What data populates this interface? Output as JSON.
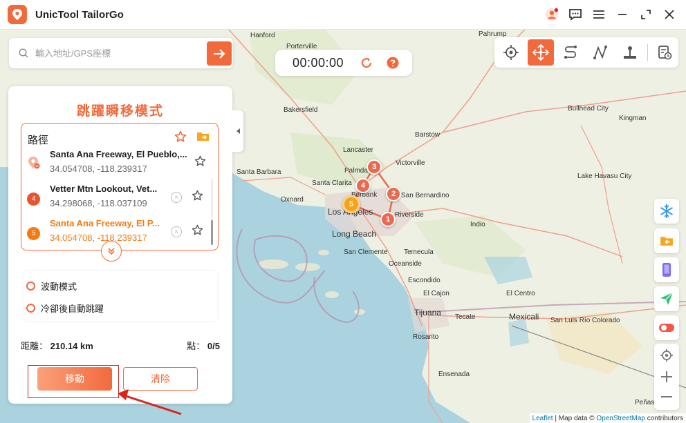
{
  "app": {
    "title": "UnicTool TailorGo"
  },
  "search": {
    "placeholder": "輸入地址/GPS座標"
  },
  "timer": {
    "value": "00:00:00"
  },
  "panel": {
    "title": "跳躍瞬移模式",
    "route_label": "路徑",
    "items": [
      {
        "name": "Santa Ana Freeway, El Pueblo,...",
        "coords": "34.054708, -118.239317",
        "badge": ""
      },
      {
        "name": "Vetter Mtn Lookout, Vet...",
        "coords": "34.298068, -118.037109",
        "badge": "4"
      },
      {
        "name": "Santa Ana Freeway, El P...",
        "coords": "34.054708, -118.239317",
        "badge": "5"
      }
    ],
    "options": {
      "wave_mode": "波動模式",
      "auto_jump": "冷卻後自動跳躍"
    },
    "distance_label": "距離：",
    "distance_value": "210.14 km",
    "points_label": "點：",
    "points_value": "0/5",
    "move_button": "移動",
    "clear_button": "清除"
  },
  "map": {
    "labels": [
      "Hanford",
      "Porterville",
      "Pahrump",
      "Bakersfield",
      "Barstow",
      "Bullhead City",
      "Kingman",
      "Lancaster",
      "Palmdale",
      "Victorville",
      "Santa Barbara",
      "Santa Clarita",
      "Lake Havasu City",
      "Oxnard",
      "Burbank",
      "San Bernardino",
      "Los Angeles",
      "Riverside",
      "Long Beach",
      "Indio",
      "San Clemente",
      "Temecula",
      "Oceanside",
      "Escondido",
      "El Cajon",
      "El Centro",
      "Tijuana",
      "Tecate",
      "Mexicali",
      "San Luis Río Colorado",
      "Rosarito",
      "Ensenada",
      "Peñas"
    ],
    "markers": [
      "1",
      "2",
      "3",
      "4",
      "5"
    ]
  },
  "attribution": {
    "leaflet": "Leaflet",
    "sep": " | Map data © ",
    "osm": "OpenStreetMap",
    "suffix": " contributors"
  },
  "colors": {
    "accent": "#f26a3c",
    "marker": "#ea6a50",
    "current": "#f8a21a"
  }
}
